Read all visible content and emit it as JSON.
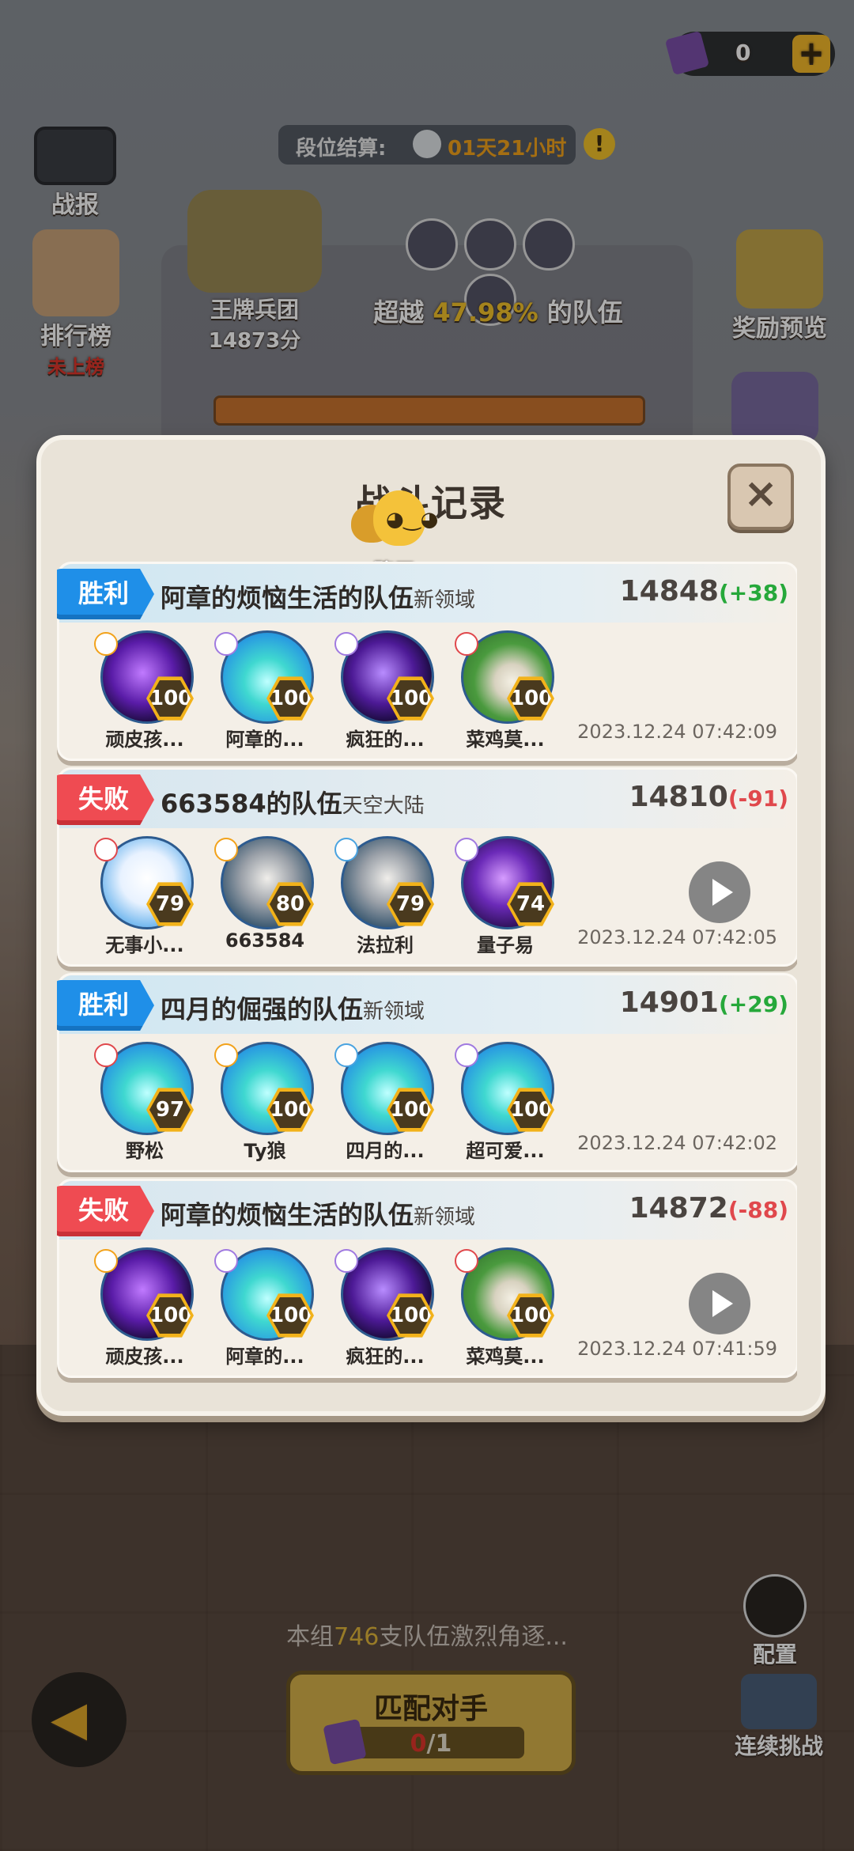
{
  "hud": {
    "ticket_count": "0",
    "season_label": "段位结算:",
    "season_time": "01天21小时",
    "battle_report_label": "战报",
    "rank_label": "排行榜",
    "rank_sub": "未上榜",
    "team_name": "王牌兵团",
    "team_score": "14873分",
    "beat_prefix": "超越",
    "beat_percent": "47.98%",
    "beat_suffix": "的队伍",
    "reward_label": "奖励预览",
    "contest_prefix": "本组",
    "contest_count": "746",
    "contest_suffix": "支队伍激烈角逐...",
    "match_label": "匹配对手",
    "match_used": "0",
    "match_total": "/1",
    "config_label": "配置",
    "challenge_label": "连续挑战"
  },
  "dialog": {
    "title": "战斗记录",
    "chat_label": "聊天",
    "close_label": "×"
  },
  "records": [
    {
      "result": "胜利",
      "team": "阿章的烦恼生活的队伍",
      "region": "新领域",
      "score": "14848",
      "delta": "(+38)",
      "time": "2023.12.24 07:42:09",
      "heroes": [
        {
          "name": "顽皮孩...",
          "level": "100"
        },
        {
          "name": "阿章的...",
          "level": "100"
        },
        {
          "name": "疯狂的...",
          "level": "100"
        },
        {
          "name": "菜鸡莫...",
          "level": "100"
        }
      ]
    },
    {
      "result": "失败",
      "team": "663584的队伍",
      "region": "天空大陆",
      "score": "14810",
      "delta": "(-91)",
      "time": "2023.12.24 07:42:05",
      "heroes": [
        {
          "name": "无事小...",
          "level": "79"
        },
        {
          "name": "663584",
          "level": "80"
        },
        {
          "name": "法拉利",
          "level": "79"
        },
        {
          "name": "量子易",
          "level": "74"
        }
      ]
    },
    {
      "result": "胜利",
      "team": "四月的倔强的队伍",
      "region": "新领域",
      "score": "14901",
      "delta": "(+29)",
      "time": "2023.12.24 07:42:02",
      "heroes": [
        {
          "name": "野松",
          "level": "97"
        },
        {
          "name": "Ty狼",
          "level": "100"
        },
        {
          "name": "四月的...",
          "level": "100"
        },
        {
          "name": "超可爱...",
          "level": "100"
        }
      ]
    },
    {
      "result": "失败",
      "team": "阿章的烦恼生活的队伍",
      "region": "新领域",
      "score": "14872",
      "delta": "(-88)",
      "time": "2023.12.24 07:41:59",
      "heroes": [
        {
          "name": "顽皮孩...",
          "level": "100"
        },
        {
          "name": "阿章的...",
          "level": "100"
        },
        {
          "name": "疯狂的...",
          "level": "100"
        },
        {
          "name": "菜鸡莫...",
          "level": "100"
        }
      ]
    }
  ]
}
